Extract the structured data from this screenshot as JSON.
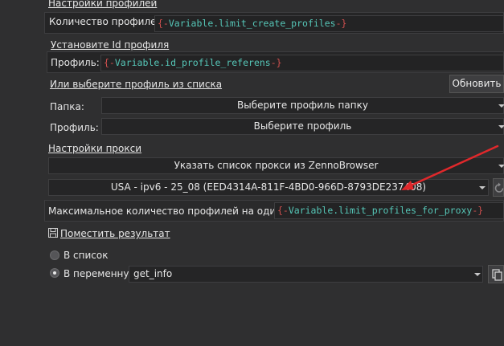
{
  "profile_settings": {
    "header": "Настройки профилей",
    "count_label": "Количество профилей:",
    "count_value_open": "{-",
    "count_value_var": "Variable.limit_create_profiles",
    "count_value_close": "-}"
  },
  "profile_id": {
    "header": "Установите Id профиля",
    "label": "Профиль:",
    "value_open": "{-",
    "value_var": "Variable.id_profile_referens",
    "value_close": "-}"
  },
  "profile_list": {
    "header": "Или выберите профиль из списка",
    "refresh_button": "Обновить",
    "folder_label": "Папка:",
    "folder_value": "Выберите профиль папку",
    "profile_label": "Профиль:",
    "profile_value": "Выберите профиль"
  },
  "proxy": {
    "header": "Настройки прокси",
    "mode_value": "Указать список прокси из ZennoBrowser",
    "list_value": "USA - ipv6 - 25_08 (EED4314A-811F-4BD0-966D-8793DE237408)",
    "max_label": "Максимальное количество профилей на один прокси:",
    "max_open": "{-",
    "max_var": "Variable.limit_profiles_for_proxy",
    "max_close": "-}"
  },
  "result": {
    "header": "Поместить результат",
    "to_list_label": "В список",
    "to_var_label": "В переменную",
    "var_value": "get_info",
    "selected": "В переменную"
  },
  "colors": {
    "background": "#2f2f30",
    "arrow": "#e0282b",
    "var_text": "#56c7b8",
    "brace": "#d2504f"
  }
}
